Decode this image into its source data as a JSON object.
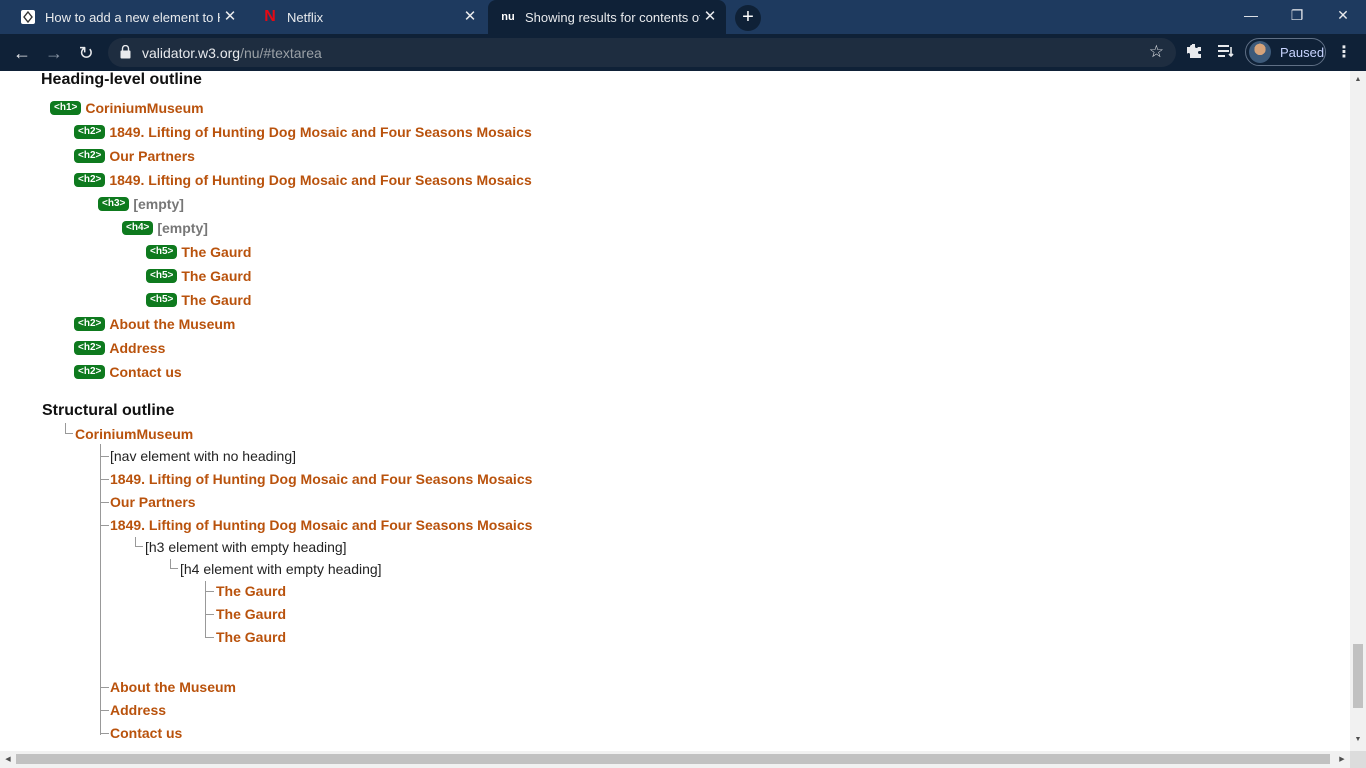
{
  "tabs": [
    {
      "title": "How to add a new element to HT",
      "favicon": "html-icon",
      "active": false
    },
    {
      "title": "Netflix",
      "favicon": "netflix-icon",
      "active": false
    },
    {
      "title": "Showing results for contents of te",
      "favicon": "nu-icon",
      "active": true
    }
  ],
  "newtab_icon": "plus-icon",
  "window_controls": [
    "minimize-icon",
    "restore-icon",
    "close-icon"
  ],
  "address": {
    "host": "validator.w3.org",
    "path": "/nu/#textarea"
  },
  "profile": {
    "label": "Paused"
  },
  "heading_outline": {
    "title": "Heading-level outline",
    "items": [
      {
        "level": "<h1>",
        "text": "CoriniumMuseum",
        "empty": false
      },
      {
        "level": "<h2>",
        "text": "1849. Lifting of Hunting Dog Mosaic and Four Seasons Mosaics",
        "empty": false
      },
      {
        "level": "<h2>",
        "text": "Our Partners",
        "empty": false
      },
      {
        "level": "<h2>",
        "text": "1849. Lifting of Hunting Dog Mosaic and Four Seasons Mosaics",
        "empty": false
      },
      {
        "level": "<h3>",
        "text": "[empty]",
        "empty": true
      },
      {
        "level": "<h4>",
        "text": "[empty]",
        "empty": true
      },
      {
        "level": "<h5>",
        "text": "The Gaurd",
        "empty": false
      },
      {
        "level": "<h5>",
        "text": "The Gaurd",
        "empty": false
      },
      {
        "level": "<h5>",
        "text": "The Gaurd",
        "empty": false
      },
      {
        "level": "<h2>",
        "text": "About the Museum",
        "empty": false
      },
      {
        "level": "<h2>",
        "text": "Address",
        "empty": false
      },
      {
        "level": "<h2>",
        "text": "Contact us",
        "empty": false
      }
    ]
  },
  "structural_outline": {
    "title": "Structural outline",
    "items": [
      {
        "text": "CoriniumMuseum",
        "link": true
      },
      {
        "text": "[nav element with no heading]",
        "link": false
      },
      {
        "text": "1849. Lifting of Hunting Dog Mosaic and Four Seasons Mosaics",
        "link": true
      },
      {
        "text": "Our Partners",
        "link": true
      },
      {
        "text": "1849. Lifting of Hunting Dog Mosaic and Four Seasons Mosaics",
        "link": true
      },
      {
        "text": "[h3 element with empty heading]",
        "link": false
      },
      {
        "text": "[h4 element with empty heading]",
        "link": false
      },
      {
        "text": "The Gaurd",
        "link": true
      },
      {
        "text": "The Gaurd",
        "link": true
      },
      {
        "text": "The Gaurd",
        "link": true
      },
      {
        "text": "About the Museum",
        "link": true
      },
      {
        "text": "Address",
        "link": true
      },
      {
        "text": "Contact us",
        "link": true
      }
    ]
  },
  "colors": {
    "badge": "#0e7a1e",
    "heading_link": "#b9520c",
    "tabbar": "#1e3a5f",
    "toolbar": "#0f2137"
  }
}
